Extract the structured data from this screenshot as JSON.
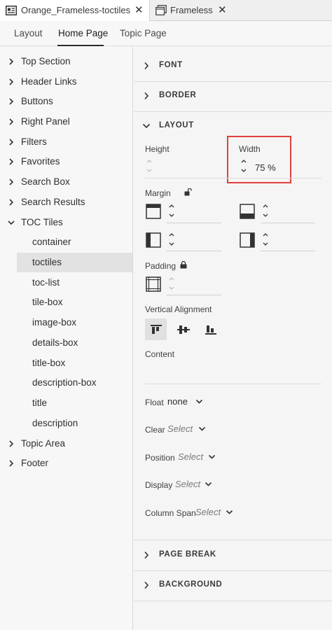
{
  "document_tabs": [
    {
      "label": "Orange_Frameless-toctiles",
      "close": "✕",
      "active": true
    },
    {
      "label": "Frameless",
      "close": "✕",
      "active": false
    }
  ],
  "sub_tabs": [
    {
      "label": "Layout",
      "active": false
    },
    {
      "label": "Home Page",
      "active": true
    },
    {
      "label": "Topic Page",
      "active": false
    }
  ],
  "tree": [
    {
      "label": "Top Section",
      "level": 0,
      "expanded": false
    },
    {
      "label": "Header Links",
      "level": 0,
      "expanded": false
    },
    {
      "label": "Buttons",
      "level": 0,
      "expanded": false
    },
    {
      "label": "Right Panel",
      "level": 0,
      "expanded": false
    },
    {
      "label": "Filters",
      "level": 0,
      "expanded": false
    },
    {
      "label": "Favorites",
      "level": 0,
      "expanded": false
    },
    {
      "label": "Search Box",
      "level": 0,
      "expanded": false
    },
    {
      "label": "Search Results",
      "level": 0,
      "expanded": false
    },
    {
      "label": "TOC Tiles",
      "level": 0,
      "expanded": true
    },
    {
      "label": "container",
      "level": 1
    },
    {
      "label": "toctiles",
      "level": 1,
      "selected": true
    },
    {
      "label": "toc-list",
      "level": 1
    },
    {
      "label": "tile-box",
      "level": 1
    },
    {
      "label": "image-box",
      "level": 1
    },
    {
      "label": "details-box",
      "level": 1
    },
    {
      "label": "title-box",
      "level": 1
    },
    {
      "label": "description-box",
      "level": 1
    },
    {
      "label": "title",
      "level": 1
    },
    {
      "label": "description",
      "level": 1
    },
    {
      "label": "Topic Area",
      "level": 0,
      "expanded": false
    },
    {
      "label": "Footer",
      "level": 0,
      "expanded": false
    }
  ],
  "sections": {
    "font": "FONT",
    "border": "BORDER",
    "layout": "LAYOUT",
    "page_break": "PAGE BREAK",
    "background": "BACKGROUND"
  },
  "layout": {
    "height_label": "Height",
    "height_value": "",
    "width_label": "Width",
    "width_value": "75 %",
    "margin_label": "Margin",
    "padding_label": "Padding",
    "vertical_alignment_label": "Vertical Alignment",
    "content_label": "Content",
    "float_label": "Float",
    "float_value": "none",
    "clear_label": "Clear",
    "clear_value": "Select",
    "position_label": "Position",
    "position_value": "Select",
    "display_label": "Display",
    "display_value": "Select",
    "column_span_label": "Column Span",
    "column_span_value": "Select"
  },
  "icons": {
    "doc_tab_1": "document-tab-icon",
    "doc_tab_2": "window-tab-icon",
    "margin_lock": "unlocked-icon",
    "padding_lock": "locked-icon"
  },
  "colors": {
    "highlight": "#e0413d",
    "panel_bg": "#f5f5f5",
    "selected_row": "#e2e2e2"
  }
}
